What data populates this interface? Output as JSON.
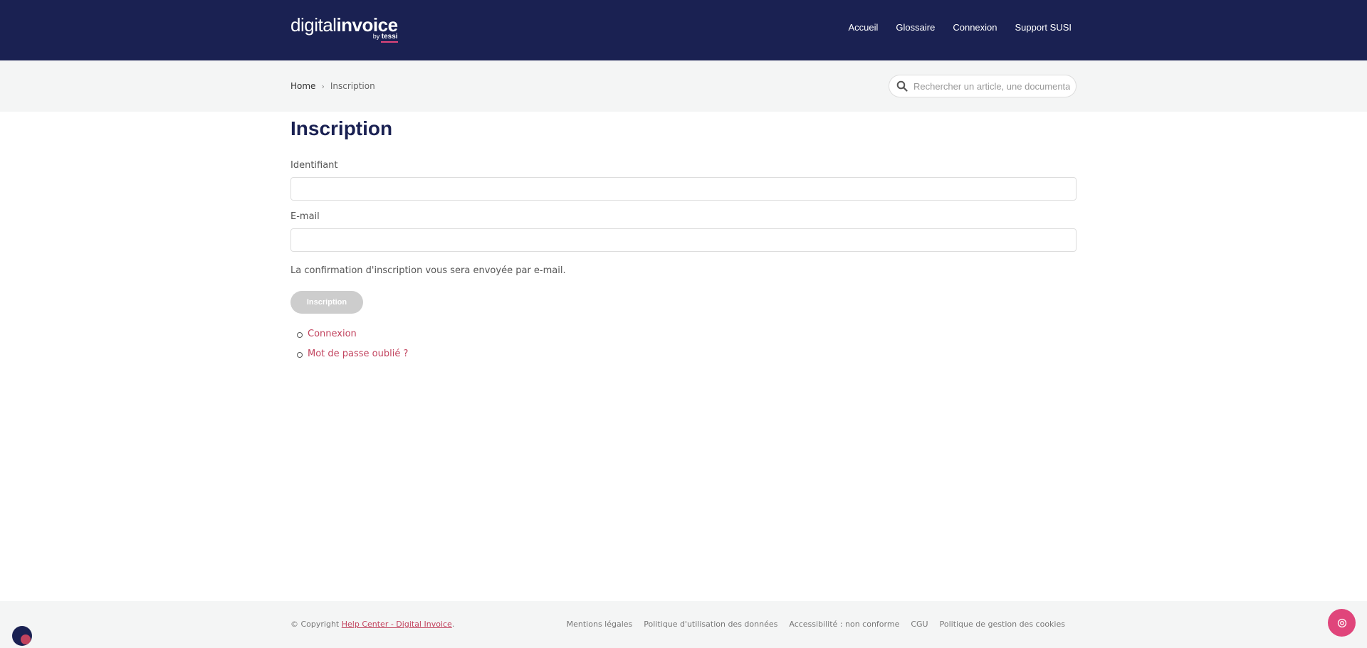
{
  "header": {
    "logo": {
      "light": "digital",
      "bold": "invoice",
      "by": "by",
      "brand": "tessi"
    },
    "nav": [
      {
        "label": "Accueil"
      },
      {
        "label": "Glossaire"
      },
      {
        "label": "Connexion"
      },
      {
        "label": "Support SUSI"
      }
    ]
  },
  "subbar": {
    "breadcrumb": {
      "home": "Home",
      "separator": "›",
      "current": "Inscription"
    },
    "search": {
      "placeholder": "Rechercher un article, une documentation"
    }
  },
  "form": {
    "title": "Inscription",
    "username_label": "Identifiant",
    "username_value": "",
    "email_label": "E-mail",
    "email_value": "",
    "note": "La confirmation d'inscription vous sera envoyée par e-mail.",
    "submit_label": "Inscription",
    "links": [
      {
        "label": "Connexion"
      },
      {
        "label": "Mot de passe oublié ?"
      }
    ]
  },
  "footer": {
    "copyright_prefix": "© Copyright ",
    "copyright_link": "Help Center - Digital Invoice",
    "copyright_suffix": ".",
    "links": [
      {
        "label": "Mentions légales"
      },
      {
        "label": "Politique d'utilisation des données"
      },
      {
        "label": "Accessibilité : non conforme"
      },
      {
        "label": "CGU"
      },
      {
        "label": "Politique de gestion des cookies"
      }
    ]
  },
  "colors": {
    "navy": "#1a2152",
    "accent": "#c2435e",
    "pink": "#e0457b",
    "button_disabled": "#cdcdcd",
    "subbar_bg": "#f4f5f5"
  },
  "icons": {
    "search": "search-icon",
    "help": "help-icon",
    "cookie": "cookie-settings-icon"
  }
}
